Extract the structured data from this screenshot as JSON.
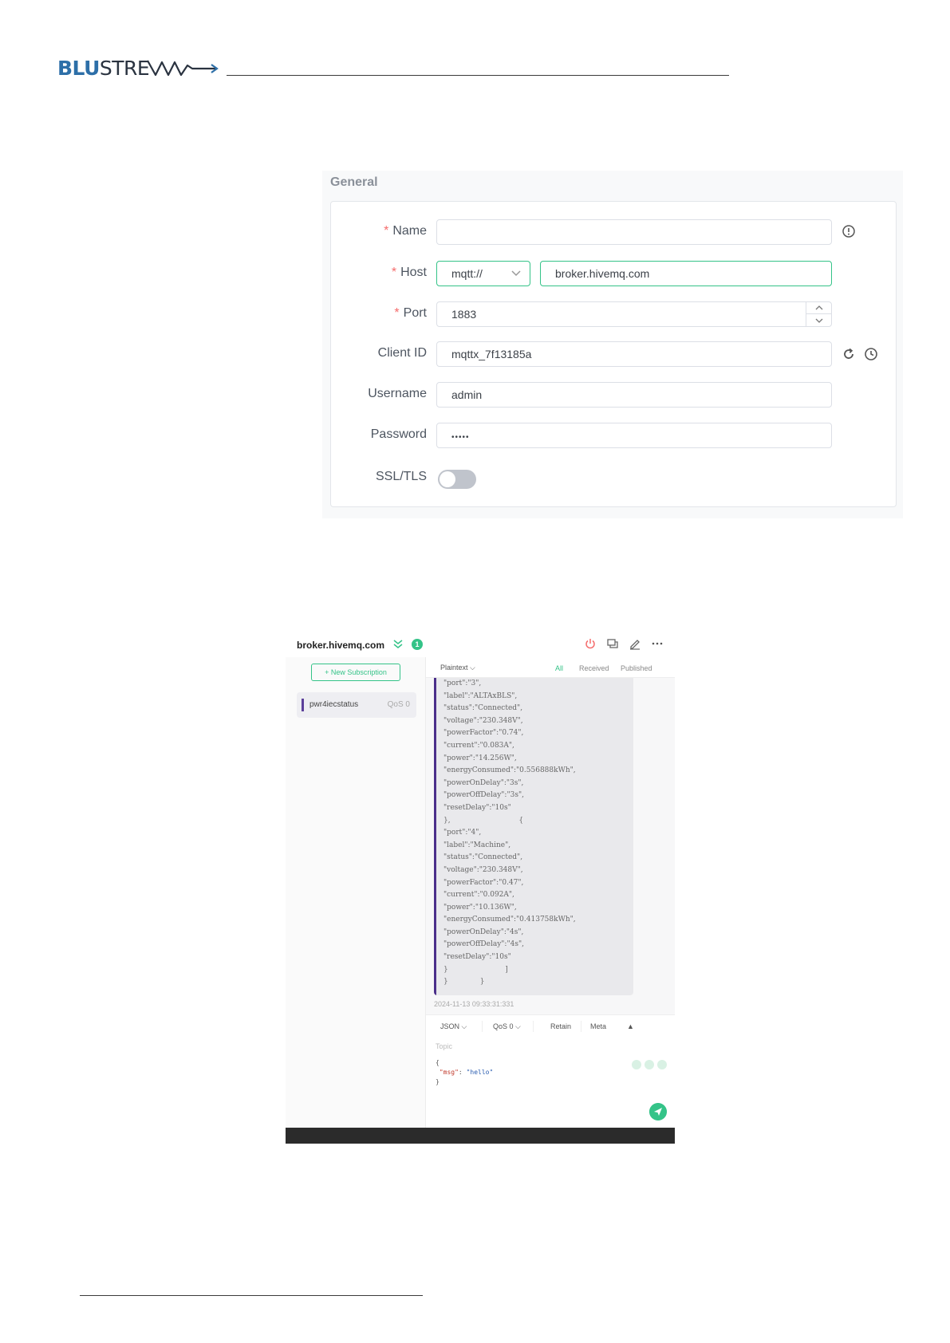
{
  "brand": {
    "part1": "BLU",
    "part2": "STRE",
    "accent": "#2d6fa8"
  },
  "general": {
    "title": "General",
    "fields": {
      "name": {
        "label": "Name",
        "required": "*",
        "value": ""
      },
      "host": {
        "label": "Host",
        "required": "*",
        "protocol": "mqtt://",
        "value": "broker.hivemq.com"
      },
      "port": {
        "label": "Port",
        "required": "*",
        "value": "1883"
      },
      "client_id": {
        "label": "Client ID",
        "value": "mqttx_7f13185a"
      },
      "username": {
        "label": "Username",
        "value": "admin"
      },
      "password": {
        "label": "Password",
        "value": "•••••"
      },
      "ssl": {
        "label": "SSL/TLS",
        "enabled": false
      }
    },
    "icons": [
      "info-icon",
      "chevron-down-icon",
      "spin-up-icon",
      "spin-down-icon",
      "refresh-icon",
      "clock-icon"
    ]
  },
  "mqttx": {
    "host": "broker.hivemq.com",
    "badge": "1",
    "header_icons": [
      "power-icon",
      "copy-icon",
      "edit-icon",
      "more-icon"
    ],
    "new_subscription": "New Subscription",
    "subscription": {
      "topic": "pwr4iecstatus",
      "qos": "QoS 0"
    },
    "format": "Plaintext",
    "filters": {
      "all": "All",
      "received": "Received",
      "published": "Published"
    },
    "message_lines": [
      "\"port\":\"3\",",
      "\"label\":\"ALTAxBLS\",",
      "\"status\":\"Connected\",",
      "\"voltage\":\"230.348V\",",
      "\"powerFactor\":\"0.74\",",
      "\"current\":\"0.083A\",",
      "\"power\":\"14.256W\",",
      "\"energyConsumed\":\"0.556888kWh\",",
      "\"powerOnDelay\":\"3s\",",
      "\"powerOffDelay\":\"3s\",",
      "\"resetDelay\":\"10s\"",
      "},                              {",
      "\"port\":\"4\",",
      "\"label\":\"Machine\",",
      "\"status\":\"Connected\",",
      "\"voltage\":\"230.348V\",",
      "\"powerFactor\":\"0.47\",",
      "\"current\":\"0.092A\",",
      "\"power\":\"10.136W\",",
      "\"energyConsumed\":\"0.413758kWh\",",
      "\"powerOnDelay\":\"4s\",",
      "\"powerOffDelay\":\"4s\",",
      "\"resetDelay\":\"10s\"",
      "}                         ]",
      "}              }"
    ],
    "timestamp": "2024-11-13 09:33:31:331",
    "publish": {
      "format": "JSON",
      "qos": "QoS 0",
      "retain": "Retain",
      "meta": "Meta",
      "topic_placeholder": "Topic",
      "payload_open": "{",
      "payload_key": "\"msg\"",
      "payload_sep": ": ",
      "payload_value": "\"hello\"",
      "payload_close": "}"
    },
    "colors": {
      "accent": "#34c388",
      "message_bar": "#4b2f8a",
      "disconnect": "#f56c6c"
    }
  }
}
